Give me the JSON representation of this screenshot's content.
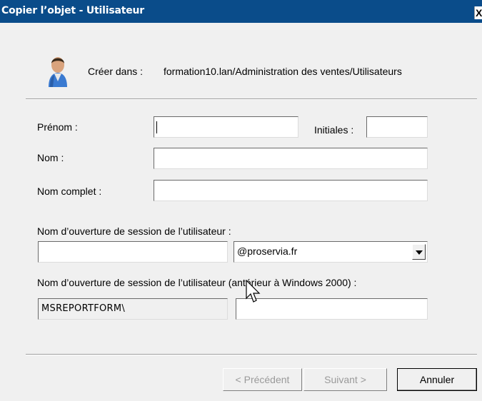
{
  "window": {
    "title": "Copier l’objet - Utilisateur",
    "close_label": "X"
  },
  "header": {
    "icon": "user-icon",
    "create_in_label": "Créer dans :",
    "create_in_path": "formation10.lan/Administration des ventes/Utilisateurs"
  },
  "form": {
    "first_name_label": "Prénom :",
    "first_name_value": "",
    "initials_label": "Initiales :",
    "initials_value": "",
    "last_name_label": "Nom :",
    "last_name_value": "",
    "full_name_label": "Nom complet :",
    "full_name_value": "",
    "logon_label": "Nom d’ouverture de session de l’utilisateur :",
    "logon_value": "",
    "domain_selected": "@proservia.fr",
    "legacy_logon_label": "Nom d’ouverture de session de l’utilisateur (antérieur à Windows 2000) :",
    "legacy_domain": "MSREPORTFORM\\",
    "legacy_logon_value": ""
  },
  "buttons": {
    "previous": "< Précédent",
    "next": "Suivant >",
    "cancel": "Annuler"
  }
}
